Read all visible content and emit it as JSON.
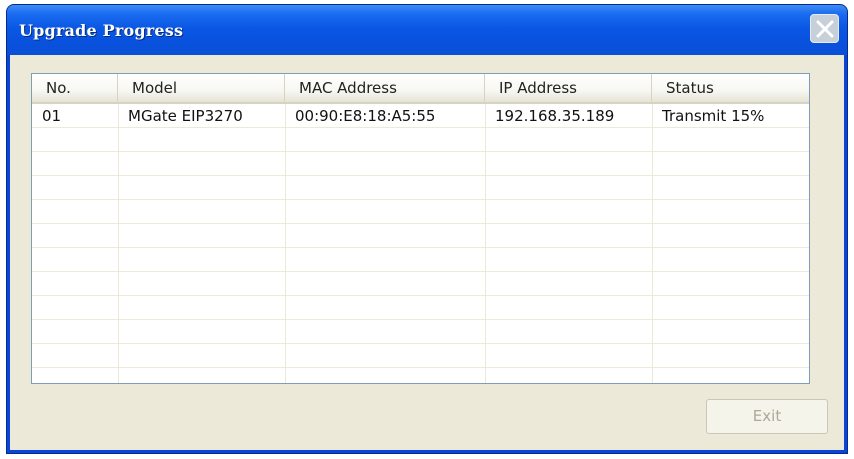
{
  "window": {
    "title": "Upgrade Progress",
    "close_icon": "close-icon"
  },
  "list": {
    "columns": [
      "No.",
      "Model",
      "MAC Address",
      "IP Address",
      "Status"
    ],
    "rows": [
      {
        "no": "01",
        "model": "MGate EIP3270",
        "mac": "00:90:E8:18:A5:55",
        "ip": "192.168.35.189",
        "status": "Transmit 15%"
      }
    ]
  },
  "buttons": {
    "exit_label": "Exit",
    "exit_enabled": false
  },
  "colors": {
    "titlebar": "#0a58e4",
    "dialog_background": "#ece9d8",
    "list_border": "#7f9db9",
    "disabled_text": "#aca899"
  }
}
